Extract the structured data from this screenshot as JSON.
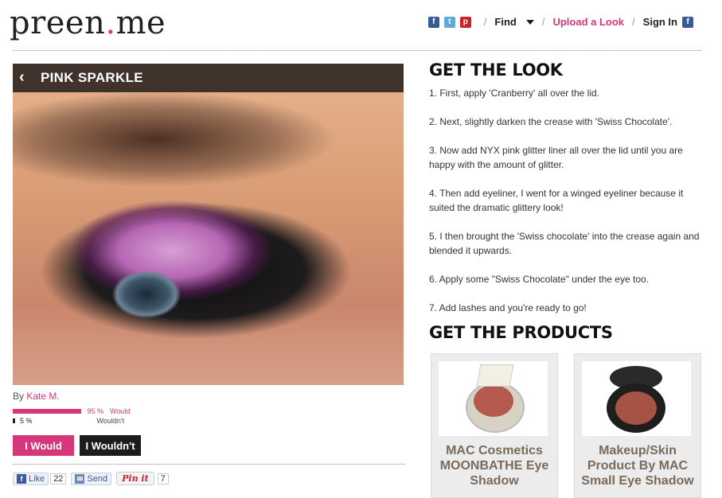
{
  "header": {
    "logo_left": "preen",
    "logo_dot": ".",
    "logo_right": "me",
    "social_icons": [
      "facebook-icon",
      "twitter-icon",
      "pinterest-icon"
    ],
    "nav": {
      "find": "Find",
      "upload": "Upload a Look",
      "signin": "Sign In"
    },
    "separator": "/"
  },
  "look": {
    "title": "PINK SPARKLE",
    "prev_arrow": "‹",
    "next_arrow": "›",
    "by_label": "By",
    "author": "Kate M.",
    "votes": {
      "would_pct_value": 95,
      "would_pct": "95 %",
      "would_label": "Would",
      "wouldnt_pct_value": 5,
      "wouldnt_pct": "5 %",
      "wouldnt_label": "Wouldn't"
    },
    "buttons": {
      "would": "I Would",
      "wouldnt": "I Wouldn't"
    },
    "social": {
      "like": "Like",
      "like_count": "22",
      "send": "Send",
      "pin": "Pin it",
      "pin_count": "7"
    }
  },
  "get_the_look": {
    "heading": "GET THE LOOK",
    "steps": [
      "1. First, apply 'Cranberry' all over the lid.",
      "2. Next, slightly darken the crease with 'Swiss Chocolate'.",
      "3. Now add NYX pink glitter liner all over the lid until you are happy with the amount of glitter.",
      "4. Then add eyeliner, I went for a winged eyeliner because it suited the dramatic glittery look!",
      "5. I then brought the 'Swiss chocolate' into the crease again and blended it upwards.",
      "6. Apply some \"Swiss Chocolate\" under the eye too.",
      "7. Add lashes and you're ready to go!"
    ]
  },
  "get_the_products": {
    "heading": "GET THE PRODUCTS",
    "products": [
      {
        "name": "MAC Cosmetics MOONBATHE Eye Shadow"
      },
      {
        "name": "Makeup/Skin Product By MAC Small Eye Shadow"
      }
    ]
  },
  "colors": {
    "accent": "#d6377a",
    "dark": "#1c1c1c",
    "product_text": "#7a6a5a"
  }
}
